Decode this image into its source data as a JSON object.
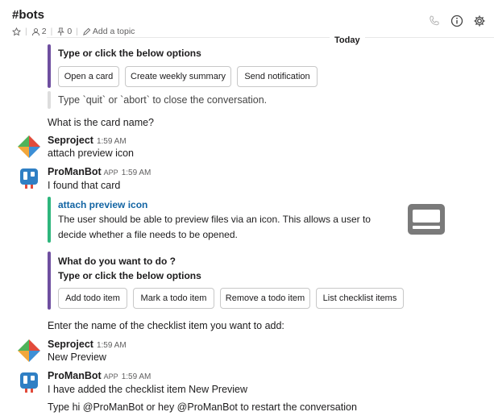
{
  "header": {
    "channel": "#bots",
    "members": "2",
    "pins": "0",
    "topic": "Add a topic"
  },
  "divider": {
    "label": "Today"
  },
  "top_attachment": {
    "title": "Type or click the below options",
    "buttons": [
      "Open a card",
      "Create weekly summary",
      "Send notification"
    ],
    "footer": "Type `quit` or `abort` to close the conversation."
  },
  "bot_prompt_1": "What is the card name?",
  "msg1": {
    "author": "Seproject",
    "time": "1:59 AM",
    "text": "attach preview icon"
  },
  "msg2": {
    "author": "ProManBot",
    "tag": "APP",
    "time": "1:59 AM",
    "text": "I found that card",
    "card_title": "attach preview icon",
    "card_desc_1": "The user should be able to preview files via an icon. This allows a user to",
    "card_desc_2": "decide whether a file needs to be opened."
  },
  "options_block": {
    "question": "What do you want to do ?",
    "title": "Type or click the below options",
    "buttons": [
      "Add todo item",
      "Mark a todo item",
      "Remove a todo item",
      "List checklist items"
    ]
  },
  "bot_prompt_2": "Enter the name of the checklist item you want to add:",
  "msg3": {
    "author": "Seproject",
    "time": "1:59 AM",
    "text": "New Preview"
  },
  "msg4": {
    "author": "ProManBot",
    "tag": "APP",
    "time": "1:59 AM",
    "text": "I have added the checklist item New Preview",
    "text2": "Type hi @ProManBot or hey @ProManBot to restart the conversation"
  },
  "colors": {
    "purple_bar": "#6f4fa0",
    "green_bar": "#2eb67d",
    "grey_bar": "#dddddd",
    "link": "#1264a3"
  },
  "icons": [
    "star-icon",
    "person-icon",
    "pin-icon",
    "pencil-icon",
    "phone-icon",
    "info-icon",
    "gear-icon",
    "laptop-icon"
  ]
}
